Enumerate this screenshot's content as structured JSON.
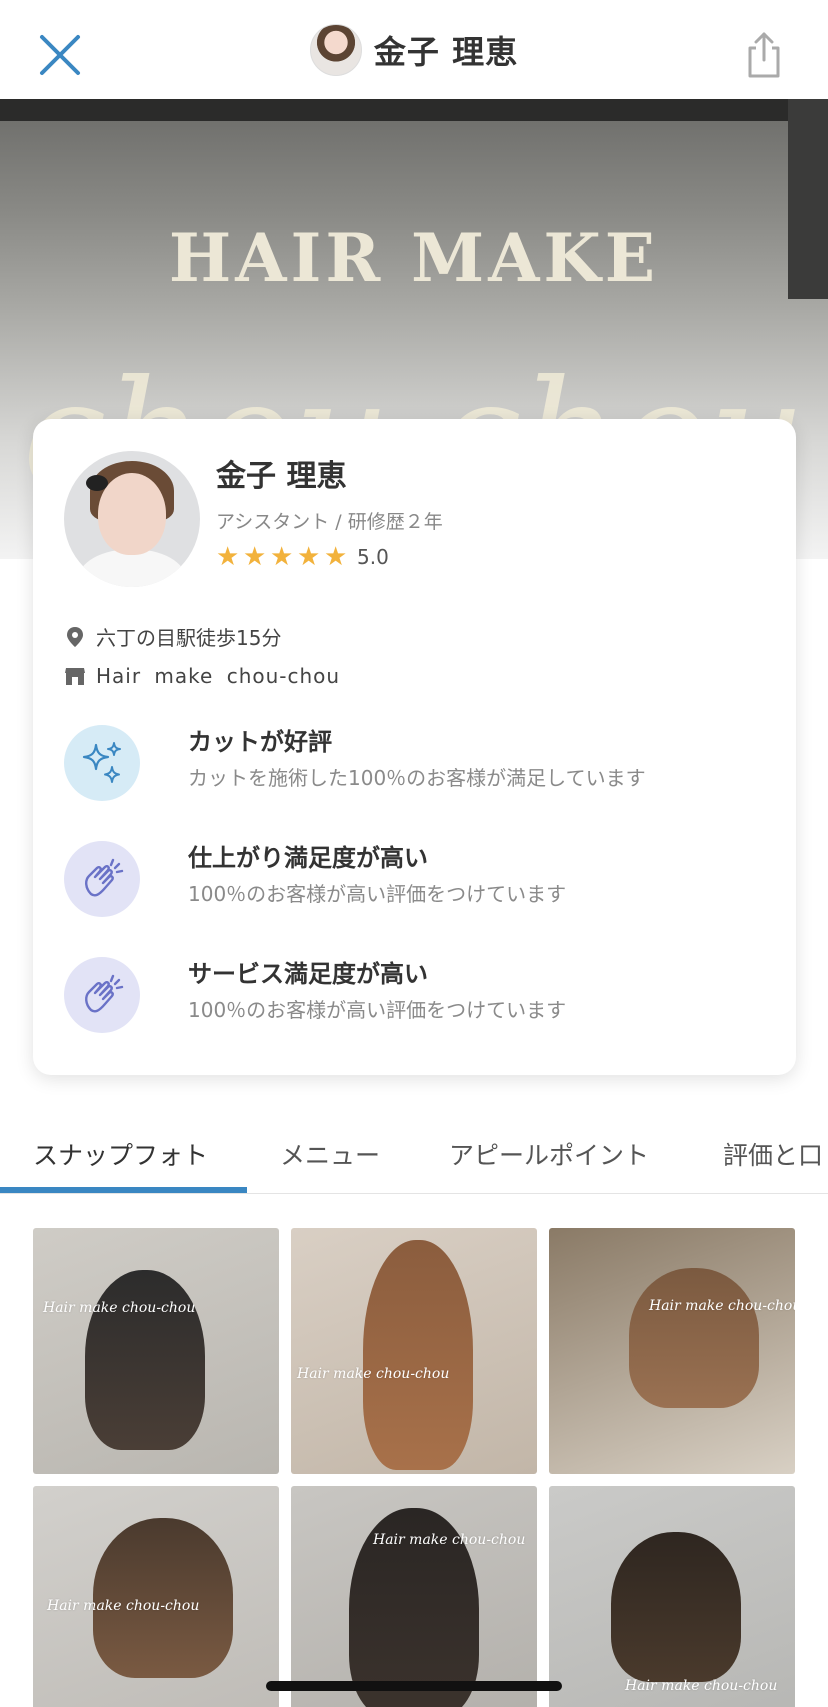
{
  "header": {
    "title": "金子 理恵"
  },
  "hero": {
    "sign_text": "HAIR MAKE",
    "script_text": "chou chou"
  },
  "profile": {
    "name": "金子 理恵",
    "role": "アシスタント / 研修歴２年",
    "rating": 5.0,
    "rating_label": "5.0",
    "stars": 5,
    "location": "六丁の目駅徒歩15分",
    "shop": "Hair make chou-chou",
    "features": [
      {
        "title": "カットが好評",
        "desc": "カットを施術した100％のお客様が満足しています",
        "icon": "sparkle-icon"
      },
      {
        "title": "仕上がり満足度が高い",
        "desc": "100％のお客様が高い評価をつけています",
        "icon": "clapping-hands-icon"
      },
      {
        "title": "サービス満足度が高い",
        "desc": "100％のお客様が高い評価をつけています",
        "icon": "clapping-hands-icon"
      }
    ]
  },
  "tabs": [
    {
      "label": "スナップフォト",
      "active": true
    },
    {
      "label": "メニュー",
      "active": false
    },
    {
      "label": "アピールポイント",
      "active": false
    },
    {
      "label": "評価と口",
      "active": false
    }
  ],
  "photos": [
    {
      "watermark": "Hair make chou-chou"
    },
    {
      "watermark": "Hair make chou-chou"
    },
    {
      "watermark": "Hair make chou-chou"
    },
    {
      "watermark": "Hair make chou-chou"
    },
    {
      "watermark": "Hair make chou-chou"
    },
    {
      "watermark": "Hair make chou-chou"
    }
  ],
  "colors": {
    "accent": "#3a87c2",
    "star": "#f2b23c",
    "sparkle_bg": "#d6ebf6",
    "hands_bg": "#e2e3f6"
  }
}
